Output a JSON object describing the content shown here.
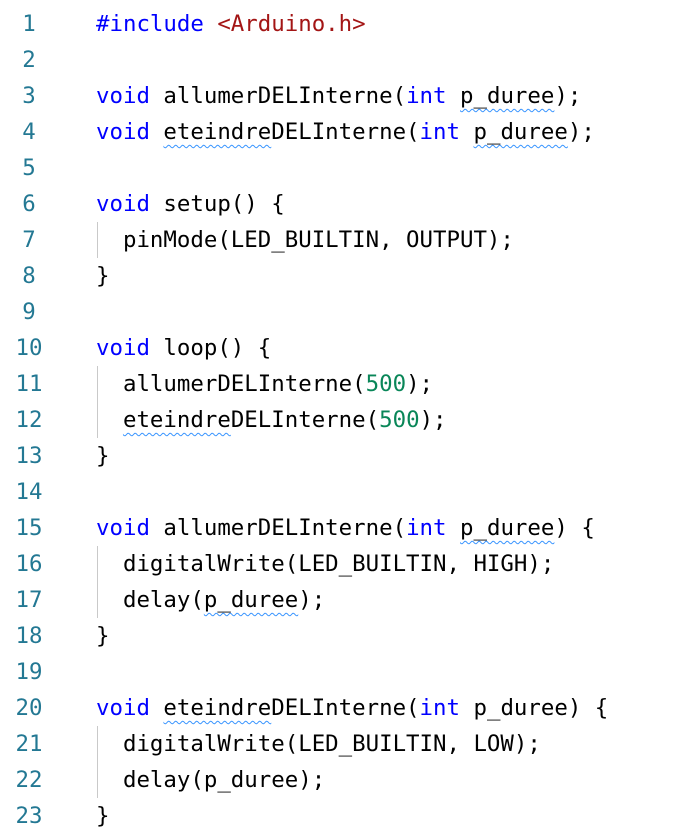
{
  "colors": {
    "background": "#ffffff",
    "line_number": "#237893",
    "keyword": "#0000ff",
    "string": "#a31515",
    "number": "#098658",
    "text": "#000000",
    "squiggle": "#3794ff",
    "indent_guide": "#c9c9c9"
  },
  "editor": {
    "language": "cpp",
    "lines": [
      {
        "n": "1",
        "indent": 0,
        "tokens": [
          {
            "t": "#include",
            "c": "keyword"
          },
          {
            "t": " ",
            "c": "punct"
          },
          {
            "t": "<Arduino.h>",
            "c": "string"
          }
        ]
      },
      {
        "n": "2",
        "indent": 0,
        "tokens": []
      },
      {
        "n": "3",
        "indent": 0,
        "tokens": [
          {
            "t": "void",
            "c": "keyword"
          },
          {
            "t": " allumerDELInterne(",
            "c": "ident"
          },
          {
            "t": "int",
            "c": "keyword"
          },
          {
            "t": " ",
            "c": "punct"
          },
          {
            "t": "p_duree",
            "c": "ident",
            "squiggle": true
          },
          {
            "t": ");",
            "c": "punct"
          }
        ]
      },
      {
        "n": "4",
        "indent": 0,
        "tokens": [
          {
            "t": "void",
            "c": "keyword"
          },
          {
            "t": " ",
            "c": "punct"
          },
          {
            "t": "eteindre",
            "c": "ident",
            "squiggle": true
          },
          {
            "t": "DELInterne(",
            "c": "ident"
          },
          {
            "t": "int",
            "c": "keyword"
          },
          {
            "t": " ",
            "c": "punct"
          },
          {
            "t": "p_duree",
            "c": "ident",
            "squiggle": true
          },
          {
            "t": ");",
            "c": "punct"
          }
        ]
      },
      {
        "n": "5",
        "indent": 0,
        "tokens": []
      },
      {
        "n": "6",
        "indent": 0,
        "tokens": [
          {
            "t": "void",
            "c": "keyword"
          },
          {
            "t": " setup() {",
            "c": "ident"
          }
        ]
      },
      {
        "n": "7",
        "indent": 1,
        "tokens": [
          {
            "t": "pinMode(LED_BUILTIN, OUTPUT);",
            "c": "ident"
          }
        ]
      },
      {
        "n": "8",
        "indent": 0,
        "tokens": [
          {
            "t": "}",
            "c": "punct"
          }
        ]
      },
      {
        "n": "9",
        "indent": 0,
        "tokens": []
      },
      {
        "n": "10",
        "indent": 0,
        "tokens": [
          {
            "t": "void",
            "c": "keyword"
          },
          {
            "t": " loop() {",
            "c": "ident"
          }
        ]
      },
      {
        "n": "11",
        "indent": 1,
        "tokens": [
          {
            "t": "allumerDELInterne(",
            "c": "ident"
          },
          {
            "t": "500",
            "c": "number"
          },
          {
            "t": ");",
            "c": "punct"
          }
        ]
      },
      {
        "n": "12",
        "indent": 1,
        "tokens": [
          {
            "t": "eteindre",
            "c": "ident",
            "squiggle": true
          },
          {
            "t": "DELInterne(",
            "c": "ident"
          },
          {
            "t": "500",
            "c": "number"
          },
          {
            "t": ");",
            "c": "punct"
          }
        ]
      },
      {
        "n": "13",
        "indent": 0,
        "tokens": [
          {
            "t": "}",
            "c": "punct"
          }
        ]
      },
      {
        "n": "14",
        "indent": 0,
        "tokens": []
      },
      {
        "n": "15",
        "indent": 0,
        "tokens": [
          {
            "t": "void",
            "c": "keyword"
          },
          {
            "t": " allumerDELInterne(",
            "c": "ident"
          },
          {
            "t": "int",
            "c": "keyword"
          },
          {
            "t": " ",
            "c": "punct"
          },
          {
            "t": "p_duree",
            "c": "ident",
            "squiggle": true
          },
          {
            "t": ") {",
            "c": "punct"
          }
        ]
      },
      {
        "n": "16",
        "indent": 1,
        "tokens": [
          {
            "t": "digitalWrite(LED_BUILTIN, HIGH);",
            "c": "ident"
          }
        ]
      },
      {
        "n": "17",
        "indent": 1,
        "tokens": [
          {
            "t": "delay(",
            "c": "ident"
          },
          {
            "t": "p_duree",
            "c": "ident",
            "squiggle": true
          },
          {
            "t": ");",
            "c": "punct"
          }
        ]
      },
      {
        "n": "18",
        "indent": 0,
        "tokens": [
          {
            "t": "}",
            "c": "punct"
          }
        ]
      },
      {
        "n": "19",
        "indent": 0,
        "tokens": []
      },
      {
        "n": "20",
        "indent": 0,
        "tokens": [
          {
            "t": "void",
            "c": "keyword"
          },
          {
            "t": " ",
            "c": "punct"
          },
          {
            "t": "eteindre",
            "c": "ident",
            "squiggle": true
          },
          {
            "t": "DELInterne(",
            "c": "ident"
          },
          {
            "t": "int",
            "c": "keyword"
          },
          {
            "t": " p_duree) {",
            "c": "ident"
          }
        ]
      },
      {
        "n": "21",
        "indent": 1,
        "tokens": [
          {
            "t": "digitalWrite(LED_BUILTIN, LOW);",
            "c": "ident"
          }
        ]
      },
      {
        "n": "22",
        "indent": 1,
        "tokens": [
          {
            "t": "delay(p_duree);",
            "c": "ident"
          }
        ]
      },
      {
        "n": "23",
        "indent": 0,
        "tokens": [
          {
            "t": "}",
            "c": "punct"
          }
        ]
      }
    ]
  }
}
